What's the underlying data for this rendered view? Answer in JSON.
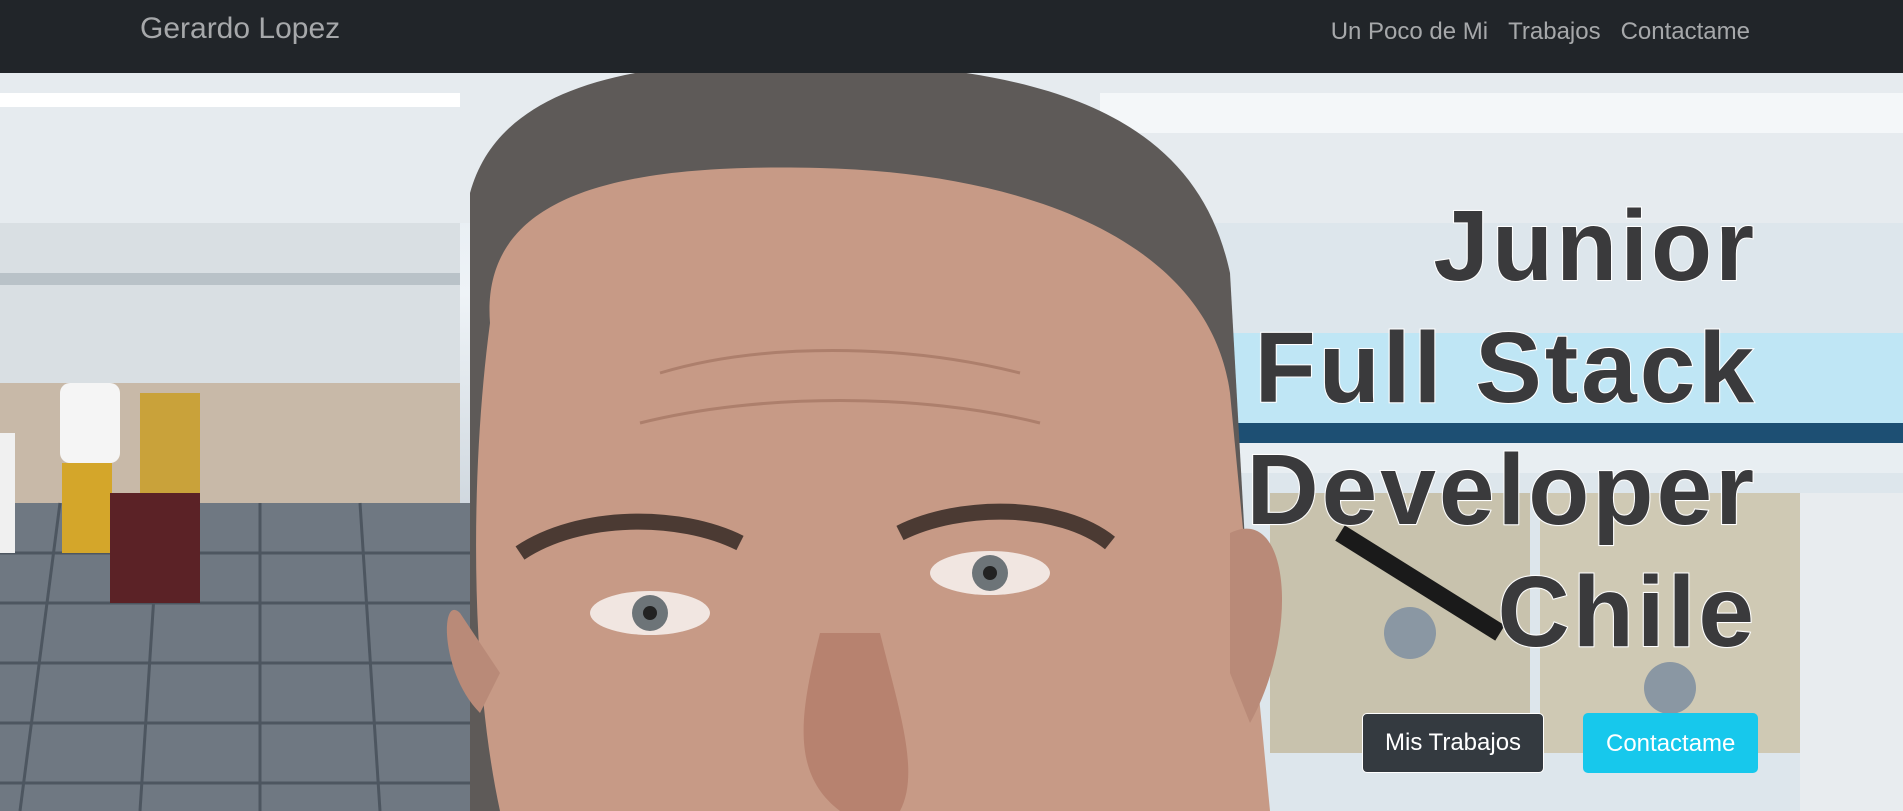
{
  "navbar": {
    "brand": "Gerardo Lopez",
    "links": [
      "Un Poco de Mi",
      "Trabajos",
      "Contactame"
    ]
  },
  "hero": {
    "headline": [
      "Junior",
      "Full Stack",
      "Developer",
      "Chile"
    ],
    "buttons": {
      "primary": "Mis Trabajos",
      "secondary": "Contactame"
    }
  },
  "colors": {
    "navbar_bg": "#212529",
    "nav_text": "#a6a8aa",
    "btn_dark": "#343a40",
    "btn_info": "#17c8ec"
  }
}
